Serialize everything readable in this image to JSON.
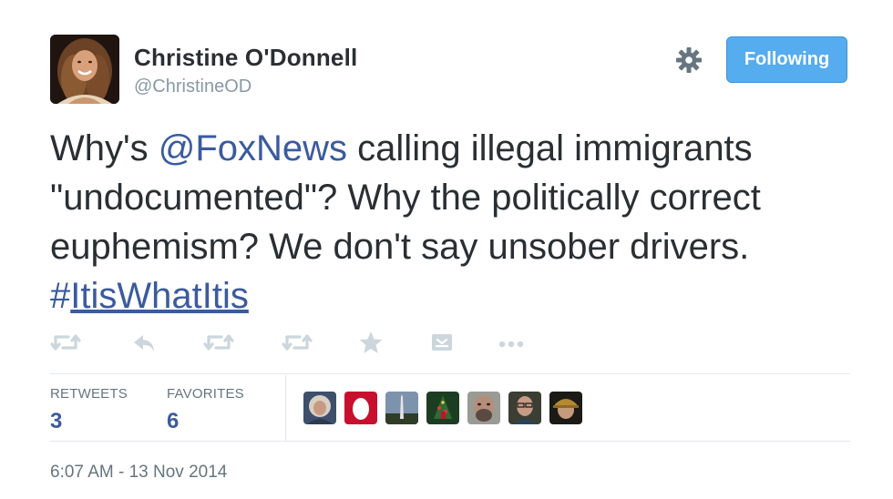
{
  "author": {
    "name": "Christine O'Donnell",
    "handle": "@ChristineOD"
  },
  "follow_button": {
    "label": "Following",
    "color": "#55acee"
  },
  "settings": {
    "icon": "gear-icon"
  },
  "tweet": {
    "prefix": "Why's ",
    "mention": "@FoxNews",
    "body": " calling illegal immigrants \"undocumented\"? Why the politically correct euphemism? We don't say unsober drivers.",
    "hashtag_symbol": "#",
    "hashtag": "ItisWhatItis",
    "link_color": "#3b5b9e"
  },
  "actions": [
    {
      "icon": "retweet-icon"
    },
    {
      "icon": "reply-icon"
    },
    {
      "icon": "retweet-icon"
    },
    {
      "icon": "retweet-icon"
    },
    {
      "icon": "favorite-star-icon"
    },
    {
      "icon": "embed-icon"
    },
    {
      "icon": "more-icon"
    }
  ],
  "stats": {
    "retweets_label": "RETWEETS",
    "retweets_count": "3",
    "favorites_label": "FAVORITES",
    "favorites_count": "6"
  },
  "favoriters": [
    {
      "avatar": "avatar-1"
    },
    {
      "avatar": "avatar-2"
    },
    {
      "avatar": "avatar-3"
    },
    {
      "avatar": "avatar-4"
    },
    {
      "avatar": "avatar-5"
    },
    {
      "avatar": "avatar-6"
    },
    {
      "avatar": "avatar-7"
    }
  ],
  "timestamp": "6:07 AM - 13 Nov 2014"
}
